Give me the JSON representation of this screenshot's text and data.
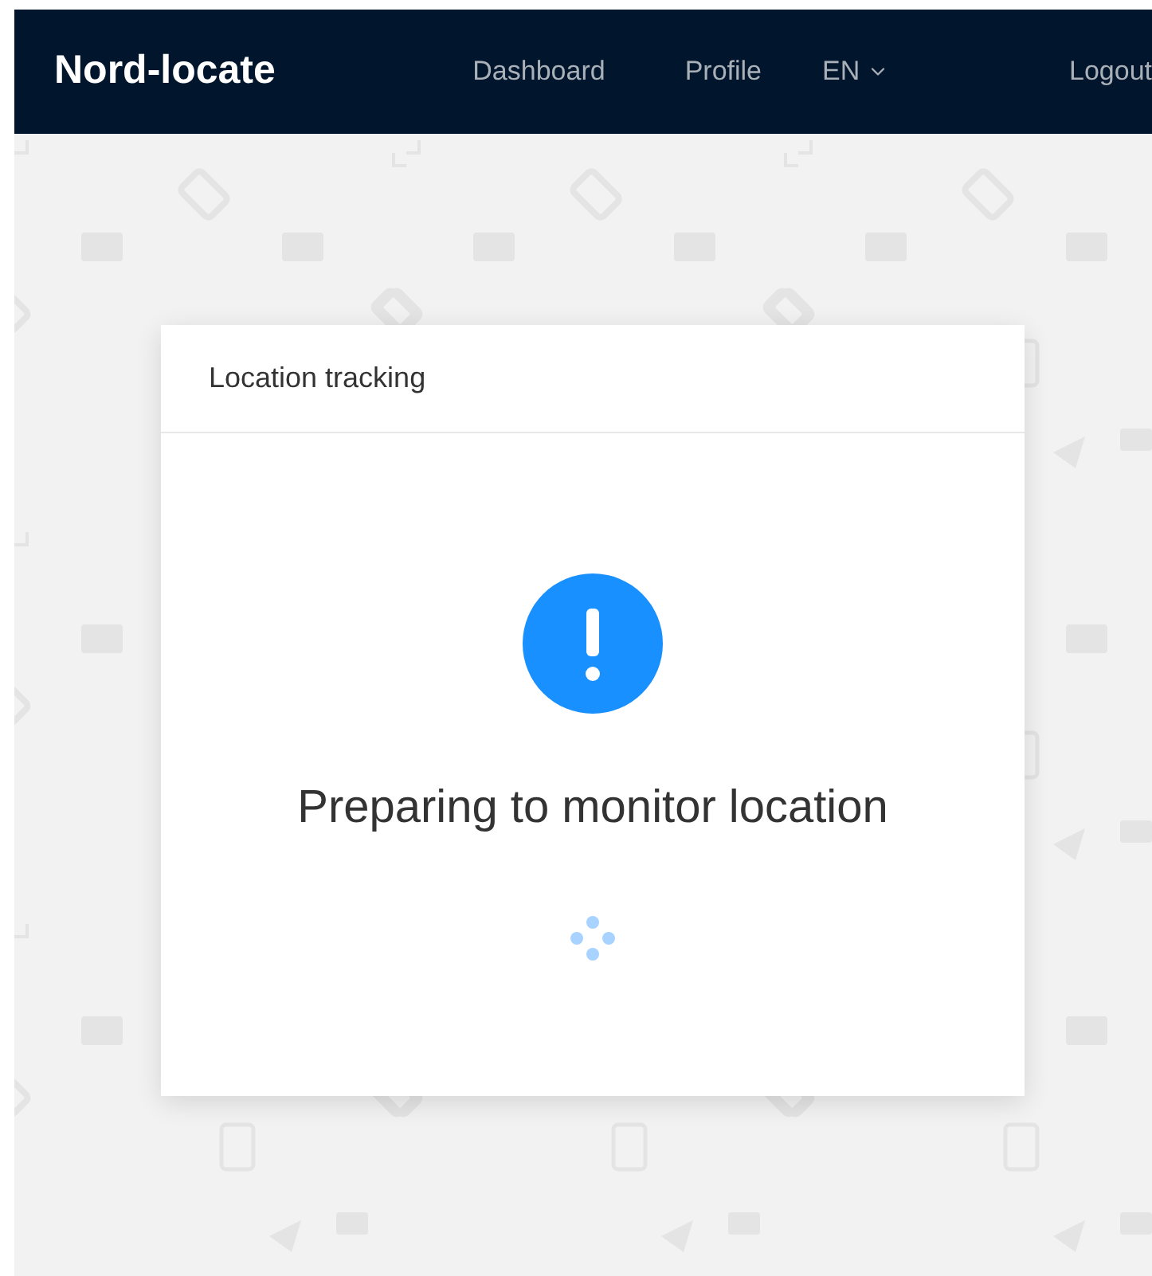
{
  "navbar": {
    "brand": "Nord-locate",
    "items": [
      {
        "kind": "link",
        "label": "Dashboard"
      },
      {
        "kind": "link",
        "label": "Profile"
      },
      {
        "kind": "dropdown",
        "label": "EN"
      },
      {
        "kind": "link",
        "label": "Logout"
      }
    ]
  },
  "card": {
    "title": "Location tracking",
    "message": "Preparing to monitor location"
  }
}
